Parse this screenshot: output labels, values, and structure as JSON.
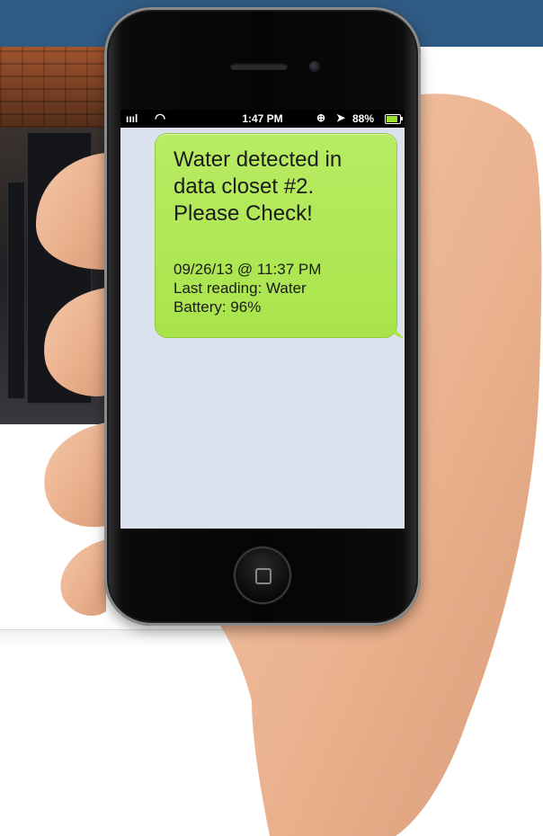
{
  "status_bar": {
    "signal": "ıııl",
    "time": "1:47 PM",
    "battery_percent": "88%",
    "battery_level": 0.88
  },
  "message": {
    "main_lines": [
      "Water detected in",
      "data closet #2.",
      "Please Check!"
    ],
    "detail_lines": [
      "09/26/13 @ 11:37 PM",
      "Last reading: Water",
      "Battery: 96%"
    ]
  },
  "icons": [
    "signal-icon",
    "wifi-icon",
    "orientation-lock-icon",
    "location-arrow-icon",
    "battery-icon",
    "home-button-icon"
  ],
  "colors": {
    "top_band": "#2f5a83",
    "bubble": "#b0e853",
    "screen_bg": "#dbe2ee"
  }
}
